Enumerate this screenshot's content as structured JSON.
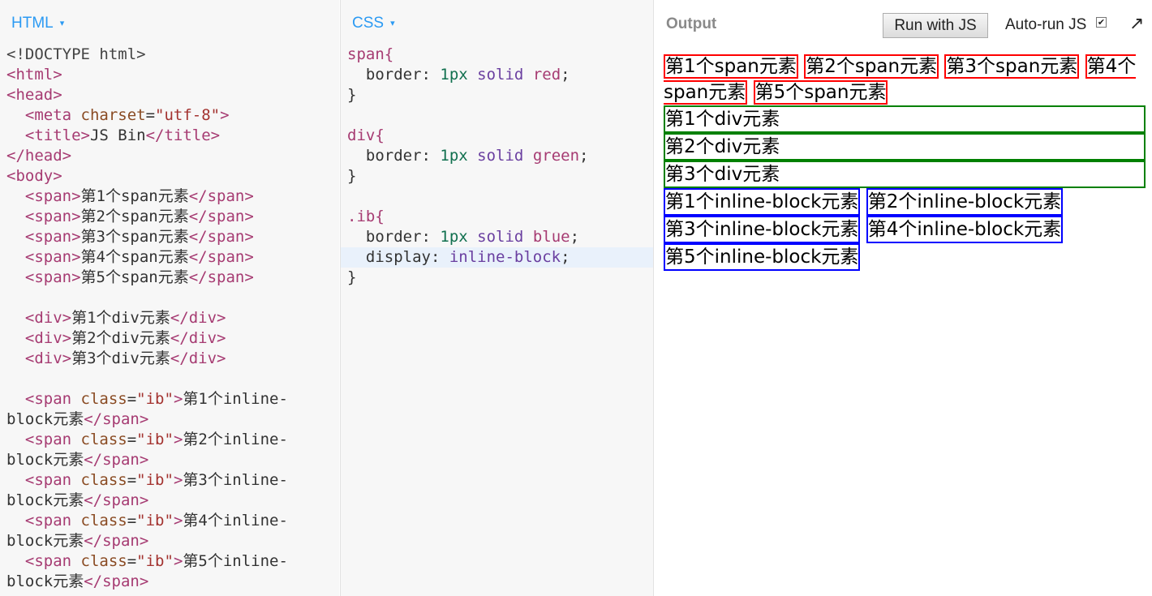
{
  "html_panel": {
    "title": "HTML",
    "caret": "▾",
    "lines": [
      [
        {
          "t": "<!DOCTYPE html>",
          "c": "c-doc"
        }
      ],
      [
        {
          "t": "<html>",
          "c": "c-tag"
        }
      ],
      [
        {
          "t": "<head>",
          "c": "c-tag"
        }
      ],
      [
        {
          "t": "  <meta ",
          "c": "c-tag"
        },
        {
          "t": "charset",
          "c": "c-attr"
        },
        {
          "t": "=",
          "c": "c-punc"
        },
        {
          "t": "\"utf-8\"",
          "c": "c-str"
        },
        {
          "t": ">",
          "c": "c-tag"
        }
      ],
      [
        {
          "t": "  <title>",
          "c": "c-tag"
        },
        {
          "t": "JS Bin",
          "c": "c-txt"
        },
        {
          "t": "</title>",
          "c": "c-tag"
        }
      ],
      [
        {
          "t": "</head>",
          "c": "c-tag"
        }
      ],
      [
        {
          "t": "<body>",
          "c": "c-tag"
        }
      ],
      [
        {
          "t": "  <span>",
          "c": "c-tag"
        },
        {
          "t": "第1个span元素",
          "c": "c-txt"
        },
        {
          "t": "</span>",
          "c": "c-tag"
        }
      ],
      [
        {
          "t": "  <span>",
          "c": "c-tag"
        },
        {
          "t": "第2个span元素",
          "c": "c-txt"
        },
        {
          "t": "</span>",
          "c": "c-tag"
        }
      ],
      [
        {
          "t": "  <span>",
          "c": "c-tag"
        },
        {
          "t": "第3个span元素",
          "c": "c-txt"
        },
        {
          "t": "</span>",
          "c": "c-tag"
        }
      ],
      [
        {
          "t": "  <span>",
          "c": "c-tag"
        },
        {
          "t": "第4个span元素",
          "c": "c-txt"
        },
        {
          "t": "</span>",
          "c": "c-tag"
        }
      ],
      [
        {
          "t": "  <span>",
          "c": "c-tag"
        },
        {
          "t": "第5个span元素",
          "c": "c-txt"
        },
        {
          "t": "</span>",
          "c": "c-tag"
        }
      ],
      [
        {
          "t": "",
          "c": "c-txt"
        }
      ],
      [
        {
          "t": "  <div>",
          "c": "c-tag"
        },
        {
          "t": "第1个div元素",
          "c": "c-txt"
        },
        {
          "t": "</div>",
          "c": "c-tag"
        }
      ],
      [
        {
          "t": "  <div>",
          "c": "c-tag"
        },
        {
          "t": "第2个div元素",
          "c": "c-txt"
        },
        {
          "t": "</div>",
          "c": "c-tag"
        }
      ],
      [
        {
          "t": "  <div>",
          "c": "c-tag"
        },
        {
          "t": "第3个div元素",
          "c": "c-txt"
        },
        {
          "t": "</div>",
          "c": "c-tag"
        }
      ],
      [
        {
          "t": "",
          "c": "c-txt"
        }
      ],
      [
        {
          "t": "  <span ",
          "c": "c-tag"
        },
        {
          "t": "class",
          "c": "c-attr"
        },
        {
          "t": "=",
          "c": "c-punc"
        },
        {
          "t": "\"ib\"",
          "c": "c-str"
        },
        {
          "t": ">",
          "c": "c-tag"
        },
        {
          "t": "第1个inline-",
          "c": "c-txt"
        }
      ],
      [
        {
          "t": "block元素",
          "c": "c-txt"
        },
        {
          "t": "</span>",
          "c": "c-tag"
        }
      ],
      [
        {
          "t": "  <span ",
          "c": "c-tag"
        },
        {
          "t": "class",
          "c": "c-attr"
        },
        {
          "t": "=",
          "c": "c-punc"
        },
        {
          "t": "\"ib\"",
          "c": "c-str"
        },
        {
          "t": ">",
          "c": "c-tag"
        },
        {
          "t": "第2个inline-",
          "c": "c-txt"
        }
      ],
      [
        {
          "t": "block元素",
          "c": "c-txt"
        },
        {
          "t": "</span>",
          "c": "c-tag"
        }
      ],
      [
        {
          "t": "  <span ",
          "c": "c-tag"
        },
        {
          "t": "class",
          "c": "c-attr"
        },
        {
          "t": "=",
          "c": "c-punc"
        },
        {
          "t": "\"ib\"",
          "c": "c-str"
        },
        {
          "t": ">",
          "c": "c-tag"
        },
        {
          "t": "第3个inline-",
          "c": "c-txt"
        }
      ],
      [
        {
          "t": "block元素",
          "c": "c-txt"
        },
        {
          "t": "</span>",
          "c": "c-tag"
        }
      ],
      [
        {
          "t": "  <span ",
          "c": "c-tag"
        },
        {
          "t": "class",
          "c": "c-attr"
        },
        {
          "t": "=",
          "c": "c-punc"
        },
        {
          "t": "\"ib\"",
          "c": "c-str"
        },
        {
          "t": ">",
          "c": "c-tag"
        },
        {
          "t": "第4个inline-",
          "c": "c-txt"
        }
      ],
      [
        {
          "t": "block元素",
          "c": "c-txt"
        },
        {
          "t": "</span>",
          "c": "c-tag"
        }
      ],
      [
        {
          "t": "  <span ",
          "c": "c-tag"
        },
        {
          "t": "class",
          "c": "c-attr"
        },
        {
          "t": "=",
          "c": "c-punc"
        },
        {
          "t": "\"ib\"",
          "c": "c-str"
        },
        {
          "t": ">",
          "c": "c-tag"
        },
        {
          "t": "第5个inline-",
          "c": "c-txt"
        }
      ],
      [
        {
          "t": "block元素",
          "c": "c-txt"
        },
        {
          "t": "</span>",
          "c": "c-tag"
        }
      ]
    ]
  },
  "css_panel": {
    "title": "CSS",
    "caret": "▾",
    "active_line": 10,
    "lines": [
      [
        {
          "t": "span{",
          "c": "c-sel"
        }
      ],
      [
        {
          "t": "  border",
          "c": "c-prop"
        },
        {
          "t": ": ",
          "c": "c-punc"
        },
        {
          "t": "1px",
          "c": "c-num"
        },
        {
          "t": " solid ",
          "c": "c-kw"
        },
        {
          "t": "red",
          "c": "c-sel"
        },
        {
          "t": ";",
          "c": "c-punc"
        }
      ],
      [
        {
          "t": "}",
          "c": "c-punc"
        }
      ],
      [
        {
          "t": "",
          "c": "c-txt"
        }
      ],
      [
        {
          "t": "div{",
          "c": "c-sel"
        }
      ],
      [
        {
          "t": "  border",
          "c": "c-prop"
        },
        {
          "t": ": ",
          "c": "c-punc"
        },
        {
          "t": "1px",
          "c": "c-num"
        },
        {
          "t": " solid ",
          "c": "c-kw"
        },
        {
          "t": "green",
          "c": "c-sel"
        },
        {
          "t": ";",
          "c": "c-punc"
        }
      ],
      [
        {
          "t": "}",
          "c": "c-punc"
        }
      ],
      [
        {
          "t": "",
          "c": "c-txt"
        }
      ],
      [
        {
          "t": ".ib{",
          "c": "c-sel"
        }
      ],
      [
        {
          "t": "  border",
          "c": "c-prop"
        },
        {
          "t": ": ",
          "c": "c-punc"
        },
        {
          "t": "1px",
          "c": "c-num"
        },
        {
          "t": " solid ",
          "c": "c-kw"
        },
        {
          "t": "blue",
          "c": "c-sel"
        },
        {
          "t": ";",
          "c": "c-punc"
        }
      ],
      [
        {
          "t": "  display",
          "c": "c-prop"
        },
        {
          "t": ": ",
          "c": "c-punc"
        },
        {
          "t": "inline-block",
          "c": "c-kw"
        },
        {
          "t": ";",
          "c": "c-punc"
        }
      ],
      [
        {
          "t": "}",
          "c": "c-punc"
        }
      ]
    ]
  },
  "output_panel": {
    "title": "Output",
    "run_button": "Run with JS",
    "autorun_label": "Auto-run JS",
    "autorun_checked": true,
    "popout_icon": "↗",
    "spans": [
      "第1个span元素",
      "第2个span元素",
      "第3个span元素",
      "第4个span元素",
      "第5个span元素"
    ],
    "divs": [
      "第1个div元素",
      "第2个div元素",
      "第3个div元素"
    ],
    "inline_blocks": [
      "第1个inline-block元素",
      "第2个inline-block元素",
      "第3个inline-block元素",
      "第4个inline-block元素",
      "第5个inline-block元素"
    ]
  },
  "colors": {
    "accent": "#2b9af3",
    "span_border": "red",
    "div_border": "green",
    "ib_border": "blue"
  }
}
